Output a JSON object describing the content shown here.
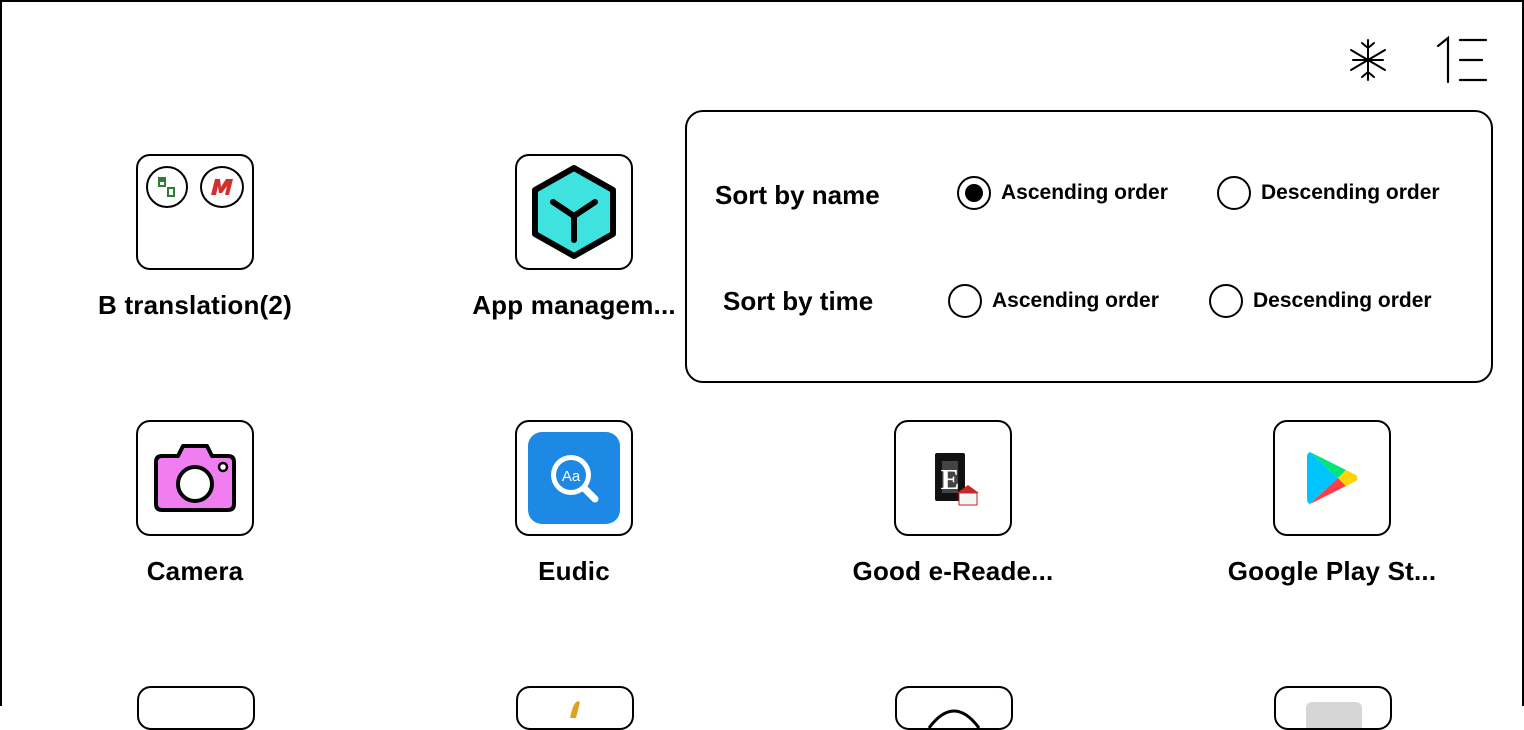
{
  "toolbar": {
    "snowflake_icon": "snowflake-icon",
    "sort_icon": "sort-icon"
  },
  "apps": [
    {
      "label": "B translation(2)",
      "icon": "folder-icon"
    },
    {
      "label": "App managem...",
      "icon": "app-management-icon"
    },
    {
      "label": "Camera",
      "icon": "camera-icon"
    },
    {
      "label": "Eudic",
      "icon": "eudic-icon"
    },
    {
      "label": "Good e-Reade...",
      "icon": "good-ereader-icon"
    },
    {
      "label": "Google Play St...",
      "icon": "google-play-icon"
    }
  ],
  "sort_popup": {
    "by_name": {
      "title": "Sort by name",
      "ascending": "Ascending order",
      "descending": "Descending order",
      "selected": "ascending"
    },
    "by_time": {
      "title": "Sort by time",
      "ascending": "Ascending order",
      "descending": "Descending order",
      "selected": "none"
    }
  },
  "colors": {
    "accent_cyan": "#3ee3e0",
    "camera_pink": "#f07ef0",
    "eudic_blue": "#1e88e5"
  }
}
